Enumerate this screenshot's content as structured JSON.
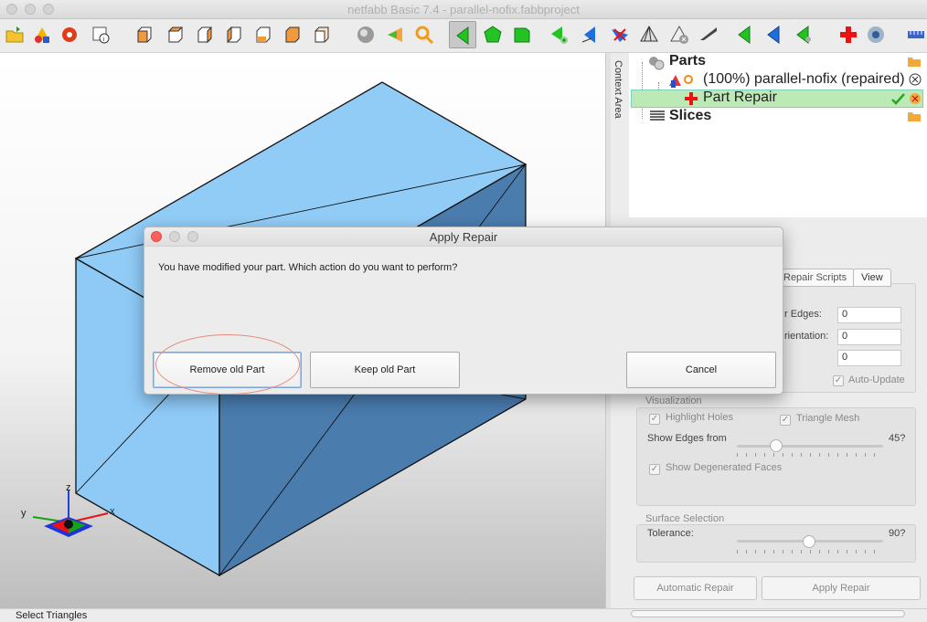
{
  "window": {
    "title": "netfabb Basic 7.4 - parallel-nofix.fabbproject"
  },
  "toolbar": {
    "buttons": [
      "open-icon",
      "add-part-icon",
      "repair-icon",
      "info-icon",
      "view-front-icon",
      "view-back-icon",
      "view-left-icon",
      "view-right-icon",
      "view-top-icon",
      "view-bottom-icon",
      "view-iso-icon",
      "sphere-icon",
      "cone-icon",
      "zoom-icon",
      "select-triangles-icon",
      "select-surface-icon",
      "select-shell-icon",
      "add-triangle-icon",
      "select-plane-icon",
      "cut-icon",
      "pyramid-icon",
      "remove-icon",
      "measure-icon",
      "move-left-icon",
      "move-back-icon",
      "move-right-icon",
      "add-repair-icon",
      "settings-icon",
      "ruler-icon"
    ]
  },
  "context_area": {
    "label": "Context Area"
  },
  "tree": {
    "parts_label": "Parts",
    "part_name": "(100%) parallel-nofix (repaired)",
    "repair_label": "Part Repair",
    "slices_label": "Slices"
  },
  "repair_panel": {
    "tabs": [
      "Repair Scripts",
      "View"
    ],
    "border_edges_label": "r Edges:",
    "border_edges_value": "0",
    "orientation_label": "rientation:",
    "orientation_value": "0",
    "third_value": "0",
    "auto_update_label": "Auto-Update",
    "visualization": {
      "title": "Visualization",
      "highlight_holes": "Highlight Holes",
      "triangle_mesh": "Triangle Mesh",
      "show_edges_label": "Show Edges from",
      "show_edges_value": "45?",
      "show_degenerated": "Show Degenerated Faces"
    },
    "surface_selection": {
      "title": "Surface Selection",
      "tolerance_label": "Tolerance:",
      "tolerance_value": "90?"
    },
    "automatic_repair": "Automatic Repair",
    "apply_repair": "Apply Repair"
  },
  "dialog": {
    "title": "Apply Repair",
    "message": "You have modified your part. Which action do you want to perform?",
    "remove_old_part": "Remove old Part",
    "keep_old_part": "Keep old Part",
    "cancel": "Cancel"
  },
  "axes": {
    "x": "x",
    "y": "y",
    "z": "z"
  },
  "status": {
    "text": "Select Triangles"
  },
  "colors": {
    "box_front": "#8fcaf6",
    "box_side": "#4a7cae",
    "tree_selected": "#bde9b6",
    "dialog_close": "#fc605b"
  }
}
